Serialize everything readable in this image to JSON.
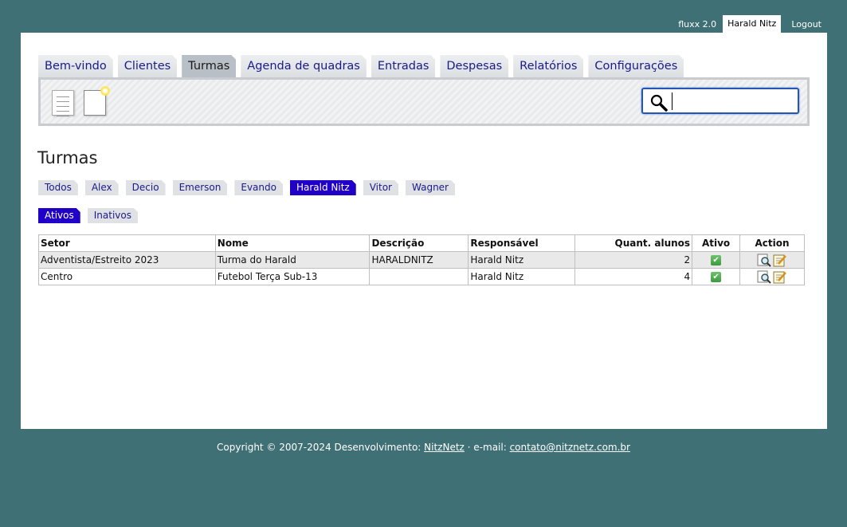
{
  "topbar": {
    "version": "fluxx 2.0",
    "user": "Harald Nitz",
    "logout": "Logout"
  },
  "tabs": [
    "Bem-vindo",
    "Clientes",
    "Turmas",
    "Agenda de quadras",
    "Entradas",
    "Despesas",
    "Relatórios",
    "Configurações"
  ],
  "active_tab": "Turmas",
  "search": {
    "value": "",
    "placeholder": ""
  },
  "page_title": "Turmas",
  "people_filter": [
    "Todos",
    "Alex",
    "Decio",
    "Emerson",
    "Evando",
    "Harald Nitz",
    "Vitor",
    "Wagner"
  ],
  "active_person": "Harald Nitz",
  "status_filter": [
    "Ativos",
    "Inativos"
  ],
  "active_status": "Ativos",
  "table": {
    "headers": [
      "Setor",
      "Nome",
      "Descrição",
      "Responsável",
      "Quant. alunos",
      "Ativo",
      "Action"
    ],
    "rows": [
      {
        "setor": "Adventista/Estreito 2023",
        "nome": "Turma do Harald",
        "descricao": "HARALDNITZ",
        "responsavel": "Harald Nitz",
        "quant": "2",
        "ativo": true
      },
      {
        "setor": "Centro",
        "nome": "Futebol Terça Sub-13",
        "descricao": "",
        "responsavel": "Harald Nitz",
        "quant": "4",
        "ativo": true
      }
    ]
  },
  "footer": {
    "prefix": "Copyright © 2007-2024 Desenvolvimento: ",
    "company": "NitzNetz",
    "sep": " · e-mail: ",
    "email": "contato@nitznetz.com.br"
  },
  "colors": {
    "background": "#3f7075",
    "active_chip": "#2000c8",
    "link": "#1a1a8a"
  }
}
